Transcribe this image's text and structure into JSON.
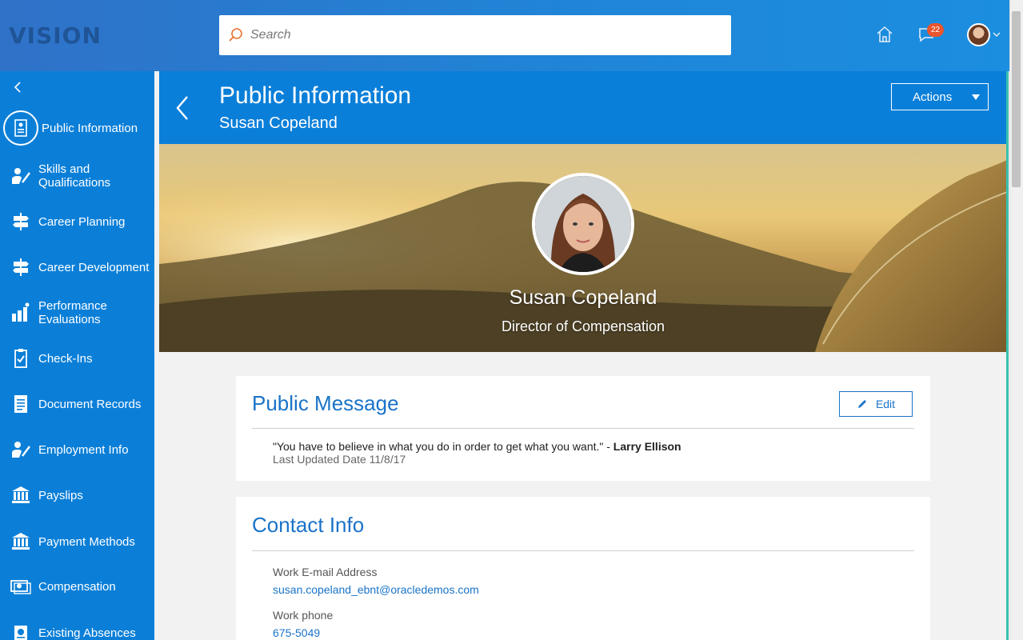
{
  "header": {
    "logo": "VISION",
    "search_placeholder": "Search",
    "notifications_count": "22"
  },
  "sidebar": {
    "items": [
      {
        "label": "Public Information",
        "icon": "id-card-icon"
      },
      {
        "label": "Skills and Qualifications",
        "icon": "person-pencil-icon"
      },
      {
        "label": "Career Planning",
        "icon": "signpost-icon"
      },
      {
        "label": "Career Development",
        "icon": "signpost-icon"
      },
      {
        "label": "Performance Evaluations",
        "icon": "bar-chart-person-icon"
      },
      {
        "label": "Check-Ins",
        "icon": "clipboard-check-icon"
      },
      {
        "label": "Document Records",
        "icon": "document-icon"
      },
      {
        "label": "Employment Info",
        "icon": "person-pencil-icon"
      },
      {
        "label": "Payslips",
        "icon": "bank-icon"
      },
      {
        "label": "Payment Methods",
        "icon": "bank-icon"
      },
      {
        "label": "Compensation",
        "icon": "money-icon"
      },
      {
        "label": "Existing Absences",
        "icon": "calendar-icon"
      }
    ]
  },
  "page": {
    "title": "Public Information",
    "subtitle": "Susan Copeland",
    "actions_label": "Actions"
  },
  "profile": {
    "name": "Susan Copeland",
    "role": "Director of Compensation"
  },
  "public_message": {
    "heading": "Public Message",
    "edit_label": "Edit",
    "quote": "\"You have to believe in what you do in order to get what you want.\" - ",
    "author": "Larry Ellison",
    "last_updated": "Last Updated Date 11/8/17"
  },
  "contact_info": {
    "heading": "Contact Info",
    "email_label": "Work E-mail Address",
    "email_value": "susan.copeland_ebnt@oracledemos.com",
    "phone_label": "Work phone",
    "phone_value": "675-5049"
  },
  "colors": {
    "header_blue": "#1f86d8",
    "sidebar_blue": "#0b7fd8",
    "accent_text": "#1a73c8",
    "badge_orange": "#e9552d"
  }
}
